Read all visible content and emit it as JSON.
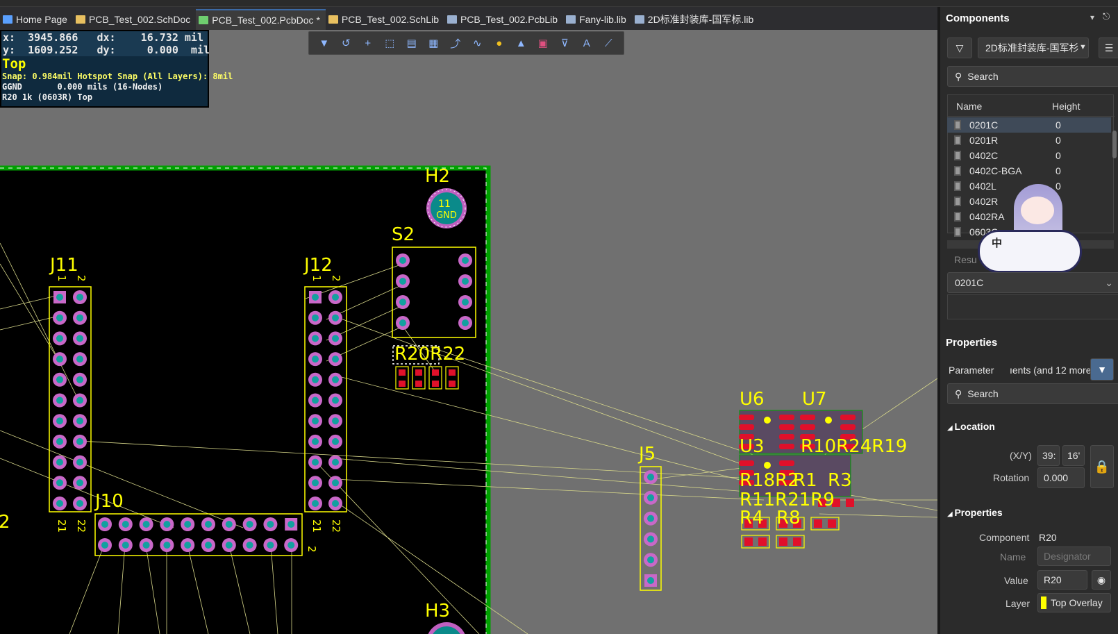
{
  "tabs": [
    {
      "label": "Home Page",
      "icon": "home-icon",
      "color": "#5aa0ff"
    },
    {
      "label": "PCB_Test_002.SchDoc",
      "icon": "schdoc-icon",
      "color": "#e8c060"
    },
    {
      "label": "PCB_Test_002.PcbDoc *",
      "icon": "pcbdoc-icon",
      "color": "#6fcf6f",
      "active": true
    },
    {
      "label": "PCB_Test_002.SchLib",
      "icon": "schlib-icon",
      "color": "#e8c060"
    },
    {
      "label": "PCB_Test_002.PcbLib",
      "icon": "pcblib-icon",
      "color": "#9ab0d0"
    },
    {
      "label": "Fany-lib.lib",
      "icon": "lib-icon",
      "color": "#9ab0d0"
    },
    {
      "label": "2D标准封装库-国军标.lib",
      "icon": "lib-icon",
      "color": "#9ab0d0"
    }
  ],
  "hud": {
    "x_line": "x:  3945.866   dx:    16.732 mil",
    "y_line": "y:  1609.252   dy:     0.000  mil",
    "layer": "Top",
    "snap": "Snap: 0.984mil Hotspot Snap (All Layers): 8mil",
    "net": "GGND       0.000 mils (16-Nodes)",
    "comp": "R20 1k (0603R) Top"
  },
  "toolbar_icons": [
    "filter-icon",
    "route-icon",
    "cross-icon",
    "select-rect-icon",
    "chart-bar-icon",
    "chip-icon",
    "interactive-route-icon",
    "diff-pair-icon",
    "pin-icon",
    "region-icon",
    "poly-icon",
    "dimension-icon",
    "text-icon",
    "line-icon"
  ],
  "pcb": {
    "designators": {
      "j11": "J11",
      "j12": "J12",
      "s2": "S2",
      "h2": "H2",
      "h3": "H3",
      "j10": "J10",
      "j5": "J5",
      "u6": "U6",
      "u7": "U7",
      "u3": "U3",
      "r10r24r19": "R10R24R19",
      "r18r2": "R18R2",
      "r1": "R1",
      "r3": "R3",
      "r11r21r9": "R11R21R9",
      "r4": "R4",
      "r8": "R8",
      "r20r22": "R20R22",
      "two_left": "2"
    },
    "pin_labels": {
      "one": "1",
      "two": "2",
      "twentyone": "21",
      "twentytwo": "22"
    },
    "h2_pad": {
      "num": "11",
      "net": "GND"
    }
  },
  "panel": {
    "components_title": "Components",
    "lib_dropdown": "2D标准封装库-国军杉",
    "search_placeholder": "Search",
    "col_name": "Name",
    "col_height": "Height",
    "rows": [
      {
        "name": "0201C",
        "height": "0"
      },
      {
        "name": "0201R",
        "height": "0"
      },
      {
        "name": "0402C",
        "height": "0"
      },
      {
        "name": "0402C-BGA",
        "height": "0"
      },
      {
        "name": "0402L",
        "height": "0"
      },
      {
        "name": "0402R",
        "height": ""
      },
      {
        "name": "0402RA",
        "height": ""
      },
      {
        "name": "0603C",
        "height": ""
      }
    ],
    "results_label": "Resu",
    "selected_footprint": "0201C",
    "mascot_badge": "中",
    "properties_title": "Properties",
    "parameter_label": "Parameter",
    "parameter_value": "ıents (and 12 more)",
    "search2_placeholder": "Search",
    "location_title": "Location",
    "xy_label": "(X/Y)",
    "x_val": "39:",
    "y_val": "16'",
    "rotation_label": "Rotation",
    "rotation_val": "0.000",
    "props_section": "Properties",
    "component_label": "Component",
    "component_val": "R20",
    "name_label": "Name",
    "name_placeholder": "Designator",
    "value_label": "Value",
    "value_val": "R20",
    "layer_label": "Layer",
    "layer_val": "Top Overlay"
  }
}
